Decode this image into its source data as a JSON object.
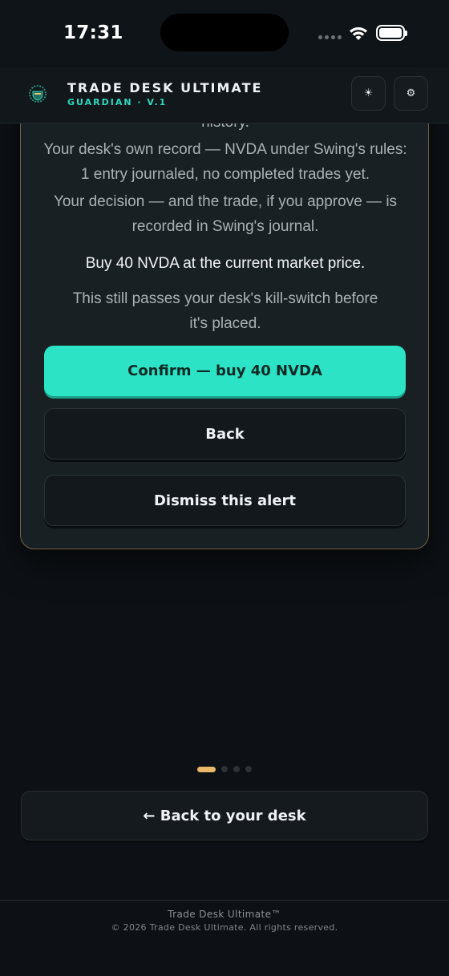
{
  "status_bar": {
    "time": "17:31",
    "icons": [
      "cellular-icon",
      "wifi-icon",
      "battery-icon"
    ]
  },
  "header": {
    "title": "TRADE DESK ULTIMATE",
    "subtitle": "GUARDIAN · V.1",
    "logo_icon": "shield-wreath-icon",
    "theme_icon": "sun-icon",
    "theme_glyph": "☀",
    "settings_icon": "gear-icon",
    "settings_glyph": "⚙"
  },
  "card": {
    "history_tail": "history.",
    "record": "Your desk's own record — NVDA under Swing's rules: 1 entry journaled, no completed trades yet.",
    "decision": "Your decision — and the trade, if you approve — is recorded in Swing's journal.",
    "action": "Buy 40 NVDA at the current market price.",
    "killswitch": "This still passes your desk's kill-switch before it's placed.",
    "confirm_label": "Confirm — buy 40 NVDA",
    "back_label": "Back",
    "dismiss_label": "Dismiss this alert"
  },
  "pager": {
    "total": 4,
    "active": 1
  },
  "back_to_desk_label": "← Back to your desk",
  "footer": {
    "title": "Trade Desk Ultimate™",
    "copyright": "© 2026 Trade Desk Ultimate. All rights reserved."
  },
  "colors": {
    "accent": "#2de3c6",
    "card_border": "#6f6045",
    "pager_active": "#eab86a",
    "background": "#0d1115"
  }
}
